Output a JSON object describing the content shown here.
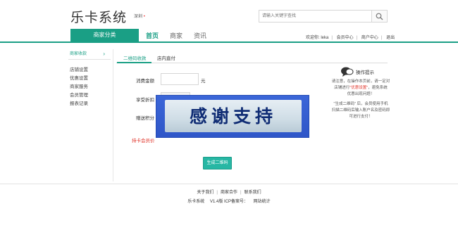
{
  "header": {
    "logo": "乐卡系统",
    "city": "深圳",
    "search_placeholder": "请输入关键字查找"
  },
  "nav": {
    "category": "商家分类",
    "items": [
      "首页",
      "商家",
      "资讯"
    ],
    "active_index": 0,
    "top_links": [
      "欢迎你: leka",
      "会员中心",
      "商户中心",
      "退出"
    ]
  },
  "sidebar": {
    "title": "商家收款",
    "items": [
      "店铺设置",
      "优惠设置",
      "商家服务",
      "会员管理",
      "报表记录"
    ]
  },
  "tabs": [
    "二维码收款",
    "店内直付"
  ],
  "form": {
    "amount_label": "消费金额",
    "amount_unit": "元",
    "discount_label": "享受折扣",
    "points_label": "赠送积分",
    "member_label": "持卡会员价",
    "generate_button": "生成二维码"
  },
  "overlay_text": "感谢支持",
  "tip": {
    "title": "操作提示",
    "line1": "请注意，在操作本页前，请一定对",
    "line2a": "店铺进行",
    "line2b": "\"优惠设置\"",
    "line2c": "，避免系统",
    "line3": "优惠出现问题！",
    "line4": "\"生成二维码\" 后，会员使用手机",
    "line5": "扫描二维码后输入账户名及密码即",
    "line6": "可进行支付！"
  },
  "footer": {
    "links": [
      "关于我们",
      "商家合作",
      "联系我们"
    ],
    "name": "乐卡系统",
    "version": "V1.4版 ICP备案号：",
    "stats": "网站统计"
  },
  "colors": {
    "brand": "#1a9f85",
    "button": "#27b7a4",
    "warning": "#e0342a",
    "overlay_blue": "#3b66d8"
  }
}
